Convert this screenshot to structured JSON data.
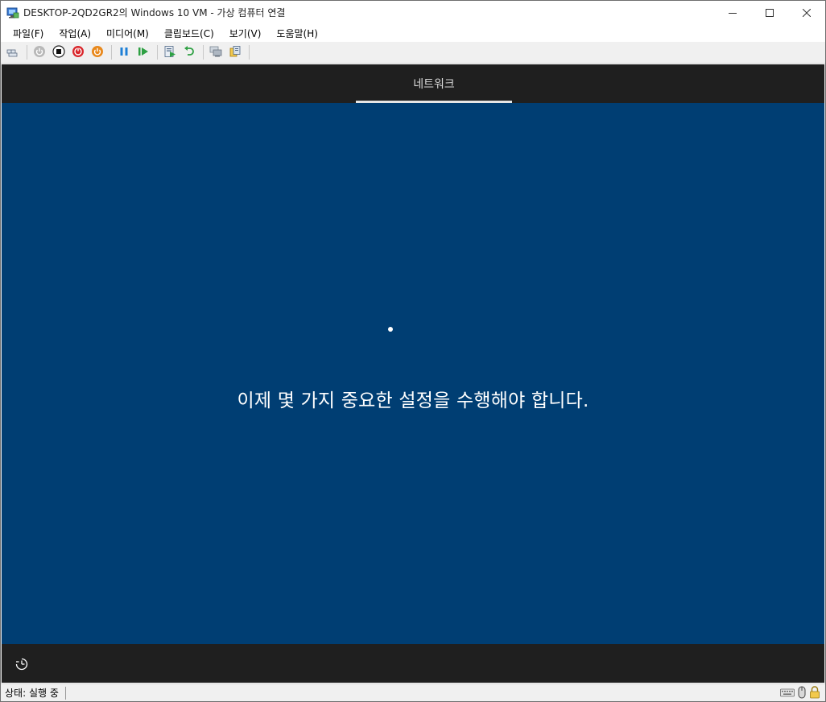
{
  "window": {
    "title": "DESKTOP-2QD2GR2의 Windows 10 VM - 가상 컴퓨터 연결",
    "icon": "vm-connect-icon"
  },
  "window_controls": {
    "minimize": "minimize-icon",
    "maximize": "maximize-icon",
    "close": "close-icon"
  },
  "menu": {
    "items": [
      {
        "label": "파일(F)"
      },
      {
        "label": "작업(A)"
      },
      {
        "label": "미디어(M)"
      },
      {
        "label": "클립보드(C)"
      },
      {
        "label": "보기(V)"
      },
      {
        "label": "도움말(H)"
      }
    ]
  },
  "toolbar": {
    "buttons": [
      "ctrl-alt-del-icon",
      "start-icon",
      "turn-off-icon",
      "shut-down-icon",
      "save-icon",
      "pause-icon",
      "resume-icon",
      "checkpoint-icon",
      "revert-icon",
      "enhanced-session-icon",
      "share-icon"
    ]
  },
  "vm": {
    "tab_label": "네트워크",
    "message": "이제 몇 가지 중요한 설정을 수행해야 합니다.",
    "ease_of_access_icon": "ease-of-access-icon"
  },
  "status": {
    "text": "상태: 실행 중",
    "icons": [
      "keyboard-icon",
      "mouse-icon",
      "lock-icon"
    ]
  },
  "colors": {
    "vm_background": "#003e73",
    "oobe_bar": "#1f1f1f",
    "message_text": "#ffffff"
  }
}
